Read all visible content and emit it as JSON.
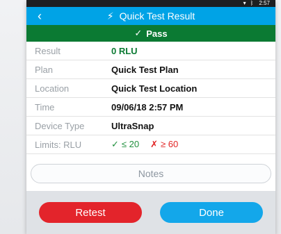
{
  "status_bar": {
    "icons": [
      "wifi-icon",
      "bluetooth-icon"
    ],
    "time": "2:57"
  },
  "app_bar": {
    "title": "Quick Test Result",
    "back_icon": "back-arrow-icon",
    "title_icon": "lightning-icon",
    "background": "#00a3e6"
  },
  "banner": {
    "text": "Pass",
    "icon": "check-icon",
    "background": "#0b7a33"
  },
  "rows": [
    {
      "label": "Result",
      "value": "0 RLU",
      "value_color": "green"
    },
    {
      "label": "Plan",
      "value": "Quick Test Plan"
    },
    {
      "label": "Location",
      "value": "Quick Test Location"
    },
    {
      "label": "Time",
      "value": "09/06/18 2:57 PM"
    },
    {
      "label": "Device Type",
      "value": "UltraSnap"
    }
  ],
  "limits": {
    "label": "Limits: RLU",
    "pass_text": "≤ 20",
    "fail_text": "≥ 60"
  },
  "notes": {
    "label": "Notes"
  },
  "buttons": {
    "retest": "Retest",
    "done": "Done",
    "retest_color": "#e3242b",
    "done_color": "#13a7ea"
  }
}
